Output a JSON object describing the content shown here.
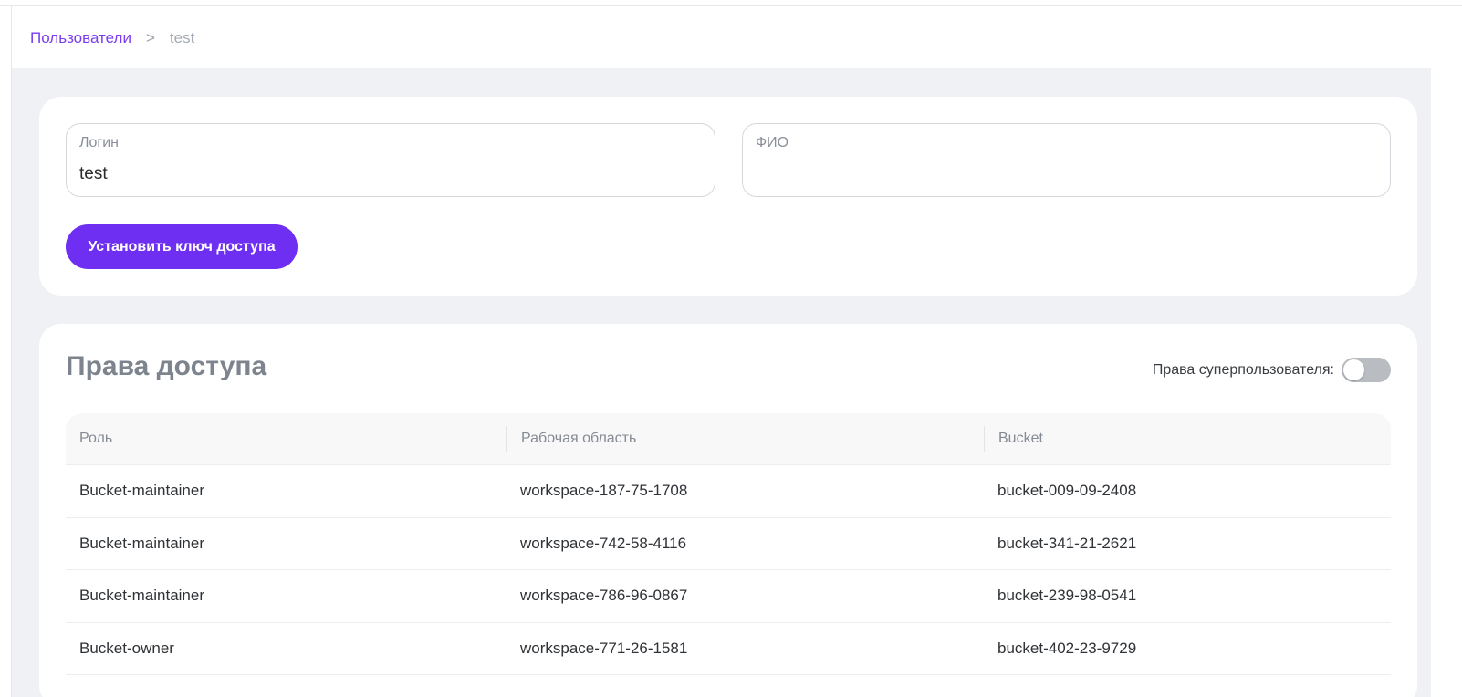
{
  "breadcrumb": {
    "parent": "Пользователи",
    "separator": ">",
    "current": "test"
  },
  "form": {
    "login_label": "Логин",
    "login_value": "test",
    "fio_label": "ФИО",
    "fio_value": "",
    "set_key_button": "Установить ключ доступа"
  },
  "access": {
    "title": "Права доступа",
    "superuser_label": "Права суперпользователя:",
    "superuser_enabled": false,
    "columns": [
      "Роль",
      "Рабочая область",
      "Bucket"
    ],
    "rows": [
      [
        "Bucket-maintainer",
        "workspace-187-75-1708",
        "bucket-009-09-2408"
      ],
      [
        "Bucket-maintainer",
        "workspace-742-58-4116",
        "bucket-341-21-2621"
      ],
      [
        "Bucket-maintainer",
        "workspace-786-96-0867",
        "bucket-239-98-0541"
      ],
      [
        "Bucket-owner",
        "workspace-771-26-1581",
        "bucket-402-23-9729"
      ]
    ]
  },
  "colors": {
    "accent": "#6f2ff2",
    "link": "#7a3df0",
    "background": "#f0f1f4"
  }
}
